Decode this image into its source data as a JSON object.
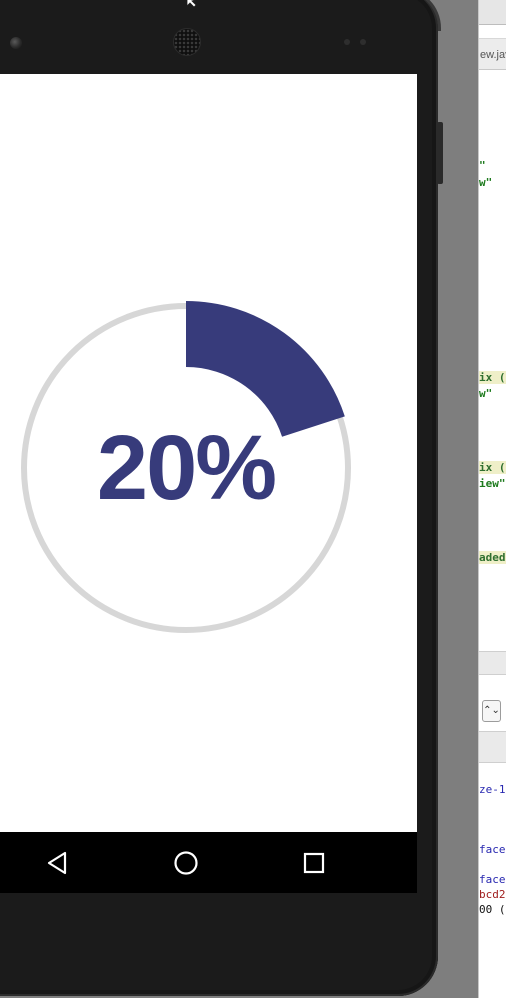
{
  "emulator": {
    "progress": {
      "percent_label": "20%",
      "value_fraction": 0.2,
      "track_color": "#d7d7d7",
      "arc_color": "#373b7b"
    },
    "nav": {
      "back_icon": "back-triangle-icon",
      "home_icon": "home-circle-icon",
      "recents_icon": "recents-square-icon"
    }
  },
  "ide": {
    "tab_label": "ew.jav",
    "code_fragments": [
      "\"",
      "w\"",
      "ix (",
      "w\"",
      "ix (",
      "iew\"",
      "aded",
      "ze-1",
      "face",
      "face",
      "bcd2",
      "00 ("
    ],
    "spinner_glyph": "⌃⌄"
  }
}
